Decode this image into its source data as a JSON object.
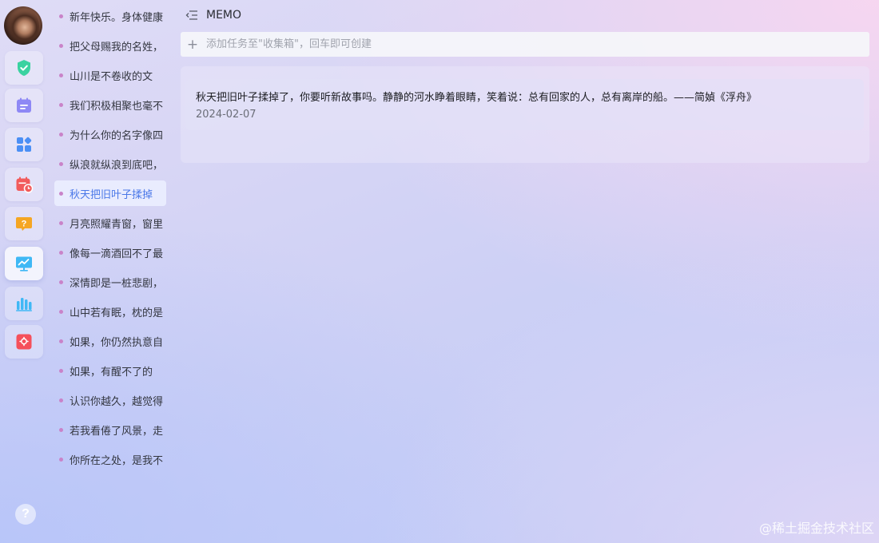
{
  "header": {
    "title": "MEMO"
  },
  "add_task": {
    "placeholder": "添加任务至\"收集箱\"，回车即可创建"
  },
  "rail": {
    "items": [
      {
        "icon": "shield-check-icon",
        "color": "#3ad2a0"
      },
      {
        "icon": "calendar-list-icon",
        "color": "#8e88f5"
      },
      {
        "icon": "apps-grid-icon",
        "color": "#4b8ff5"
      },
      {
        "icon": "calendar-clock-icon",
        "color": "#f25b5b"
      },
      {
        "icon": "question-bubble-icon",
        "color": "#f5a623"
      },
      {
        "icon": "monitor-chart-icon",
        "color": "#3fb8f5",
        "active": true
      },
      {
        "icon": "bar-chart-icon",
        "color": "#3fb8f5"
      },
      {
        "icon": "flower-card-icon",
        "color": "#f5505b"
      }
    ],
    "help_icon_text": "?"
  },
  "memo_list": {
    "items": [
      {
        "label": "新年快乐。身体健康"
      },
      {
        "label": "把父母赐我的名姓，"
      },
      {
        "label": "山川是不卷收的文"
      },
      {
        "label": "我们积极相聚也毫不"
      },
      {
        "label": "为什么你的名字像四"
      },
      {
        "label": "纵浪就纵浪到底吧，"
      },
      {
        "label": "秋天把旧叶子揉掉",
        "selected": true
      },
      {
        "label": "月亮照耀青窗，窗里"
      },
      {
        "label": "像每一滴酒回不了最"
      },
      {
        "label": "深情即是一桩悲剧，"
      },
      {
        "label": "山中若有眠，枕的是"
      },
      {
        "label": "如果，你仍然执意自"
      },
      {
        "label": "如果，有醒不了的"
      },
      {
        "label": "认识你越久，越觉得"
      },
      {
        "label": "若我看倦了风景，走"
      },
      {
        "label": "你所在之处，是我不"
      }
    ]
  },
  "memo_detail": {
    "text": "秋天把旧叶子揉掉了，你要听新故事吗。静静的河水睁着眼睛，笑着说：总有回家的人，总有离岸的船。——简媜《浮舟》",
    "date": "2024-02-07"
  },
  "watermark": "@稀土掘金技术社区",
  "colors": {
    "accent": "#4a78e8",
    "dot": "#c983c9"
  }
}
